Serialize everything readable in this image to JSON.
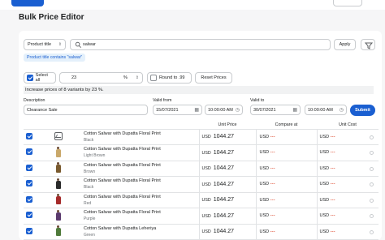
{
  "page": {
    "title": "Bulk Price Editor"
  },
  "filter": {
    "field_label": "Product title",
    "search_value": "salwar",
    "apply_label": "Apply",
    "active_tag": "Product title contains \"salwar\""
  },
  "bulk": {
    "select_all_label": "Select all",
    "amount_value": "23",
    "unit_label": "%",
    "round_label": "Round to .99",
    "reset_label": "Reset Prices",
    "summary": "Increase prices of 8 variants by 23 %."
  },
  "campaign": {
    "description_label": "Description",
    "description_value": "Clearance Sale",
    "valid_from_label": "Valid from",
    "valid_from_date": "15/07/2021",
    "valid_from_time": "10:00:00 AM",
    "valid_to_label": "Valid to",
    "valid_to_date": "30/07/2021",
    "valid_to_time": "10:00:00 AM",
    "submit_label": "Submit"
  },
  "table": {
    "headers": {
      "unit_price": "Unit Price",
      "compare_at": "Compare at",
      "unit_cost": "Unit Cost"
    },
    "currency": "USD",
    "rows": [
      {
        "title": "Cotton Salwar with Dupatta Floral Print",
        "variant": "Black",
        "price": "1044.27",
        "compare": "---",
        "cost": "---",
        "image": "placeholder",
        "color": ""
      },
      {
        "title": "Cotton Salwar with Dupatta Floral Print",
        "variant": "Light Brown",
        "price": "1044.27",
        "compare": "---",
        "cost": "---",
        "image": "product",
        "color": "#c9a86a"
      },
      {
        "title": "Cotton Salwar with Dupatta Floral Print",
        "variant": "Brown",
        "price": "1044.27",
        "compare": "---",
        "cost": "---",
        "image": "product",
        "color": "#7a5a2e"
      },
      {
        "title": "Cotton Salwar with Dupatta Floral Print",
        "variant": "Black",
        "price": "1044.27",
        "compare": "---",
        "cost": "---",
        "image": "product",
        "color": "#2a2a2a"
      },
      {
        "title": "Cotton Salwar with Dupatta Floral Print",
        "variant": "Red",
        "price": "1044.27",
        "compare": "---",
        "cost": "---",
        "image": "product",
        "color": "#a52a2a"
      },
      {
        "title": "Cotton Salwar with Dupatta Floral Print",
        "variant": "Purple",
        "price": "1044.27",
        "compare": "---",
        "cost": "---",
        "image": "product",
        "color": "#5b3a6e"
      },
      {
        "title": "Cotton Salwar with Dupatta Leheriya",
        "variant": "Green",
        "price": "1044.27",
        "compare": "---",
        "cost": "---",
        "image": "product",
        "color": "#4f7a3a"
      }
    ]
  },
  "colors": {
    "accent": "#1a5fd1",
    "danger": "#d72c0d"
  }
}
